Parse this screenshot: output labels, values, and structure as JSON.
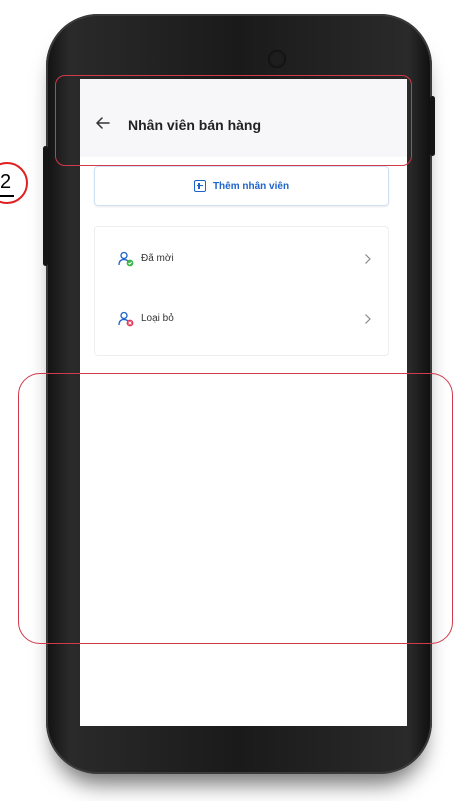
{
  "app_bar": {
    "title": "Nhân viên bán hàng"
  },
  "add_button": {
    "label": "Thêm nhân viên"
  },
  "list": [
    {
      "label": "Đã mời"
    },
    {
      "label": "Loại bỏ"
    }
  ],
  "annotation": {
    "step_number": "2"
  },
  "colors": {
    "accent": "#1e63c9",
    "annotation": "#d03a4a",
    "success": "#3cb54a",
    "danger": "#e03a5a"
  }
}
